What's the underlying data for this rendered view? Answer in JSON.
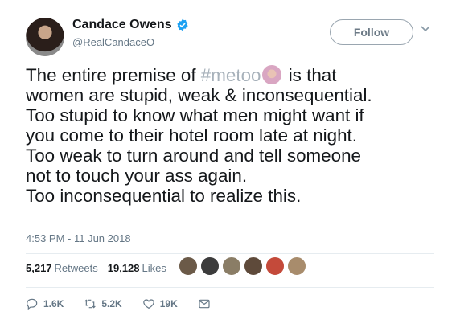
{
  "author": {
    "name": "Candace Owens",
    "handle": "@RealCandaceO",
    "verified_icon": "verified-badge-icon"
  },
  "follow_label": "Follow",
  "tweet": {
    "lines": [
      {
        "before": "The entire premise of ",
        "hashtag": "#metoo",
        "after": " is that"
      },
      {
        "text": "women are stupid, weak & inconsequential."
      },
      {
        "text": "Too stupid to know what men might want if"
      },
      {
        "text": "you come to their hotel room late at night."
      },
      {
        "text": "Too weak to turn around and tell someone"
      },
      {
        "text": "not to touch your ass again."
      },
      {
        "text": "Too inconsequential to realize this."
      }
    ]
  },
  "timestamp": "4:53 PM - 11 Jun 2018",
  "stats": {
    "retweets_count": "5,217",
    "retweets_label": "Retweets",
    "likes_count": "19,128",
    "likes_label": "Likes"
  },
  "likers": [
    {
      "color": "#6b5a48"
    },
    {
      "color": "#3c3c3c"
    },
    {
      "color": "#8a7d66"
    },
    {
      "color": "#5e4a3a"
    },
    {
      "color": "#c44a3a"
    },
    {
      "color": "#a88c6c"
    }
  ],
  "actions": {
    "reply_count": "1.6K",
    "retweet_count": "5.2K",
    "like_count": "19K"
  },
  "colors": {
    "accent": "#1da1f2",
    "secondary_text": "#657786",
    "hashtag": "#a7b1ba"
  }
}
